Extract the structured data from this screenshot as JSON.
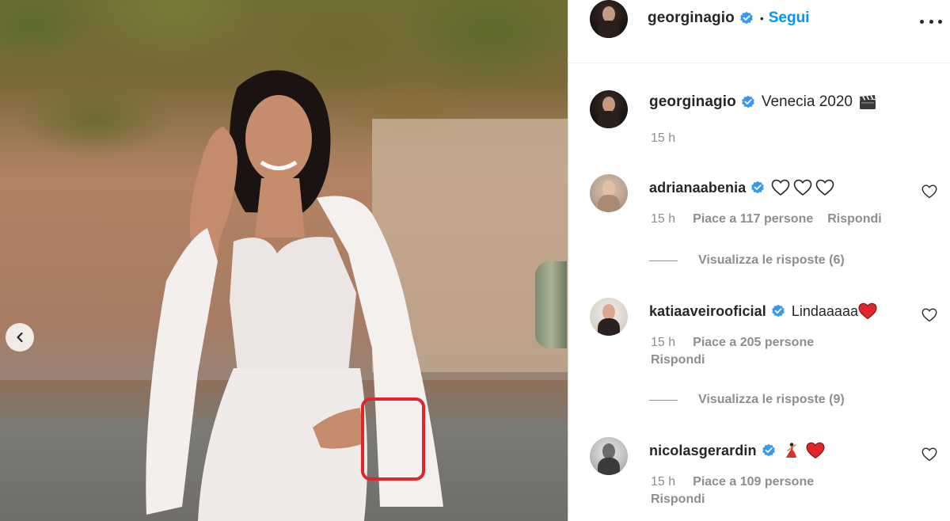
{
  "post": {
    "author": "georginagio",
    "follow_label": "Segui",
    "dot": "•"
  },
  "caption": {
    "username": "georginagio",
    "text": "Venecia 2020",
    "emoji_icon": "clapper-board-icon",
    "time": "15 h"
  },
  "comments": [
    {
      "username": "adrianaabenia",
      "verified": true,
      "emojis": [
        "outline-heart-icon",
        "outline-heart-icon",
        "outline-heart-icon"
      ],
      "text": "",
      "time": "15 h",
      "likes": "Piace a 117 persone",
      "reply": "Rispondi",
      "view_replies": "Visualizza le risposte (6)"
    },
    {
      "username": "katiaaveirooficial",
      "verified": true,
      "text": "Lindaaaaa",
      "emojis": [
        "red-heart-icon"
      ],
      "time": "15 h",
      "likes": "Piace a 205 persone",
      "reply": "Rispondi",
      "view_replies": "Visualizza le risposte (9)"
    },
    {
      "username": "nicolasgerardin",
      "verified": true,
      "text": "",
      "emojis": [
        "dancer-icon",
        "red-heart-icon"
      ],
      "time": "15 h",
      "likes": "Piace a 109 persone",
      "reply": "Rispondi"
    }
  ],
  "colors": {
    "accent": "#0095f6",
    "verified": "#3897f0",
    "muted": "#8e8e8e",
    "highlight": "#e0262a",
    "heart": "#ed4956"
  }
}
